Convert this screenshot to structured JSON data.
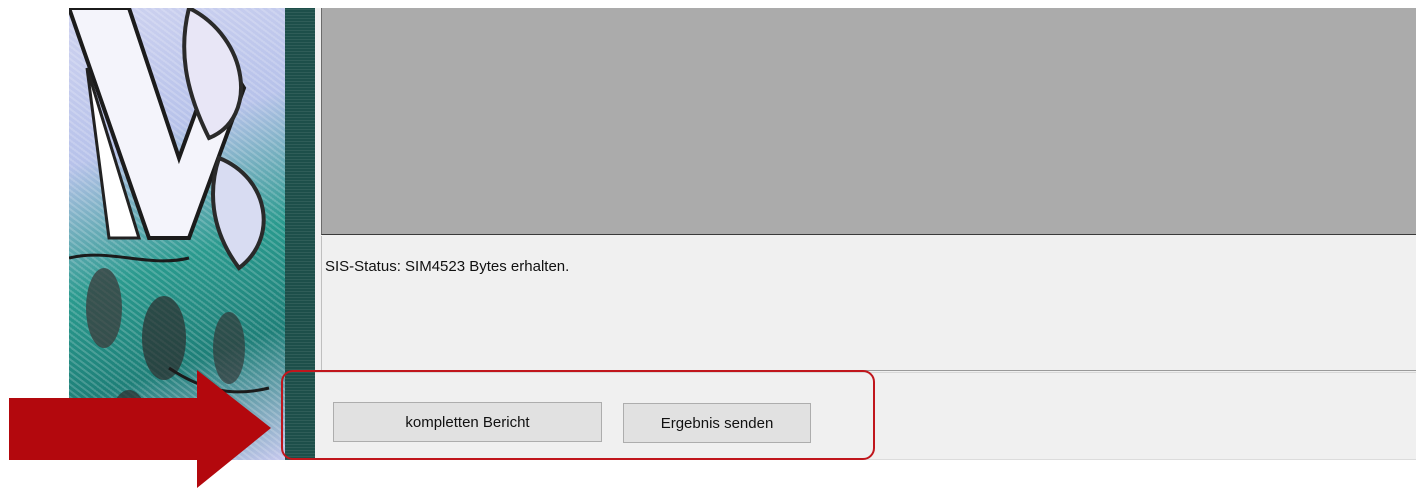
{
  "status": {
    "text": "SIS-Status: SIM4523 Bytes erhalten."
  },
  "buttons": {
    "full_report_label": "kompletten Bericht",
    "send_result_label": "Ergebnis senden"
  },
  "annotation": {
    "arrow_icon": "right-arrow-icon",
    "highlight_color": "#c0161c",
    "arrow_color": "#b3080d"
  },
  "colors": {
    "display_area": "#ababab",
    "panel_background": "#f0f0f0",
    "button_face": "#e1e1e1",
    "side_strip": "#1d4f4a"
  }
}
